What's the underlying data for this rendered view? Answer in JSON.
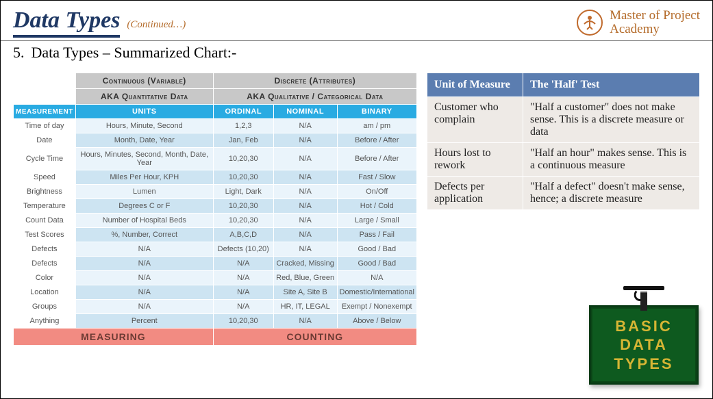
{
  "header": {
    "title": "Data Types",
    "continued": "(Continued…)",
    "brand_line1": "Master of Project",
    "brand_line2": "Academy"
  },
  "section": {
    "number": "5.",
    "title": "Data Types – Summarized Chart:-"
  },
  "table": {
    "group_top": {
      "continuous": "Continuous (Variable)",
      "discrete": "Discrete (Attributes)"
    },
    "group_aka": {
      "quant": "AKA Quantitative Data",
      "qual": "AKA Qualitative / Categorical Data"
    },
    "headers": {
      "measurement": "MEASUREMENT",
      "units": "UNITS",
      "ordinal": "ORDINAL",
      "nominal": "NOMINAL",
      "binary": "BINARY"
    },
    "rows": [
      {
        "m": "Time of day",
        "u": "Hours, Minute, Second",
        "o": "1,2,3",
        "n": "N/A",
        "b": "am / pm"
      },
      {
        "m": "Date",
        "u": "Month, Date, Year",
        "o": "Jan, Feb",
        "n": "N/A",
        "b": "Before / After"
      },
      {
        "m": "Cycle Time",
        "u": "Hours, Minutes, Second, Month, Date, Year",
        "o": "10,20,30",
        "n": "N/A",
        "b": "Before / After"
      },
      {
        "m": "Speed",
        "u": "Miles Per Hour, KPH",
        "o": "10,20,30",
        "n": "N/A",
        "b": "Fast / Slow"
      },
      {
        "m": "Brightness",
        "u": "Lumen",
        "o": "Light, Dark",
        "n": "N/A",
        "b": "On/Off"
      },
      {
        "m": "Temperature",
        "u": "Degrees C or F",
        "o": "10,20,30",
        "n": "N/A",
        "b": "Hot / Cold"
      },
      {
        "m": "Count Data",
        "u": "Number of Hospital Beds",
        "o": "10,20,30",
        "n": "N/A",
        "b": "Large / Small"
      },
      {
        "m": "Test Scores",
        "u": "%, Number, Correct",
        "o": "A,B,C,D",
        "n": "N/A",
        "b": "Pass / Fail"
      },
      {
        "m": "Defects",
        "u": "N/A",
        "o": "Defects (10,20)",
        "n": "N/A",
        "b": "Good / Bad"
      },
      {
        "m": "Defects",
        "u": "N/A",
        "o": "N/A",
        "n": "Cracked, Missing",
        "b": "Good / Bad"
      },
      {
        "m": "Color",
        "u": "N/A",
        "o": "N/A",
        "n": "Red, Blue, Green",
        "b": "N/A"
      },
      {
        "m": "Location",
        "u": "N/A",
        "o": "N/A",
        "n": "Site A, Site B",
        "b": "Domestic/International"
      },
      {
        "m": "Groups",
        "u": "N/A",
        "o": "N/A",
        "n": "HR, IT, LEGAL",
        "b": "Exempt / Nonexempt"
      },
      {
        "m": "Anything",
        "u": "Percent",
        "o": "10,20,30",
        "n": "N/A",
        "b": "Above / Below"
      }
    ],
    "footer": {
      "measuring": "MEASURING",
      "counting": "COUNTING"
    }
  },
  "half": {
    "col1": "Unit of Measure",
    "col2": "The 'Half' Test",
    "rows": [
      {
        "u": "Customer who complain",
        "t": "\"Half a customer\" does not make sense. This is a discrete measure or data"
      },
      {
        "u": "Hours lost to rework",
        "t": "\"Half an hour\" makes sense. This is a continuous measure"
      },
      {
        "u": "Defects per application",
        "t": "\"Half a defect\" doesn't make sense, hence; a discrete measure"
      }
    ]
  },
  "sign": {
    "line1": "BASIC",
    "line2": "DATA",
    "line3": "TYPES"
  }
}
